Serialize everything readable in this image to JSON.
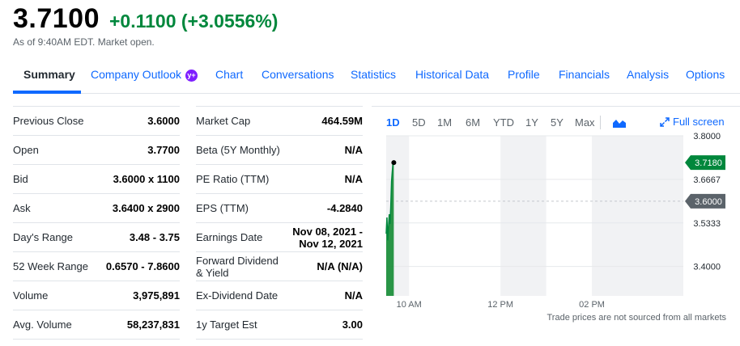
{
  "quote": {
    "price": "3.7100",
    "change": "+0.1100 (+3.0556%)",
    "status": "As of 9:40AM EDT. Market open."
  },
  "tabs": [
    {
      "label": "Summary"
    },
    {
      "label": "Company Outlook",
      "badge": "y+"
    },
    {
      "label": "Chart"
    },
    {
      "label": "Conversations"
    },
    {
      "label": "Statistics"
    },
    {
      "label": "Historical Data"
    },
    {
      "label": "Profile"
    },
    {
      "label": "Financials"
    },
    {
      "label": "Analysis"
    },
    {
      "label": "Options"
    }
  ],
  "left_stats": [
    {
      "label": "Previous Close",
      "value": "3.6000"
    },
    {
      "label": "Open",
      "value": "3.7700"
    },
    {
      "label": "Bid",
      "value": "3.6000 x 1100"
    },
    {
      "label": "Ask",
      "value": "3.6400 x 2900"
    },
    {
      "label": "Day's Range",
      "value": "3.48 - 3.75"
    },
    {
      "label": "52 Week Range",
      "value": "0.6570 - 7.8600"
    },
    {
      "label": "Volume",
      "value": "3,975,891"
    },
    {
      "label": "Avg. Volume",
      "value": "58,237,831"
    }
  ],
  "right_stats": [
    {
      "label": "Market Cap",
      "value": "464.59M"
    },
    {
      "label": "Beta (5Y Monthly)",
      "value": "N/A"
    },
    {
      "label": "PE Ratio (TTM)",
      "value": "N/A"
    },
    {
      "label": "EPS (TTM)",
      "value": "-4.2840"
    },
    {
      "label": "Earnings Date",
      "value": "Nov 08, 2021 - Nov 12, 2021"
    },
    {
      "label": "Forward Dividend & Yield",
      "value": "N/A (N/A)"
    },
    {
      "label": "Ex-Dividend Date",
      "value": "N/A"
    },
    {
      "label": "1y Target Est",
      "value": "3.00"
    }
  ],
  "chart": {
    "ranges": [
      "1D",
      "5D",
      "1M",
      "6M",
      "YTD",
      "1Y",
      "5Y",
      "Max"
    ],
    "active_range": "1D",
    "chart_type_icon": "mountain-chart-icon",
    "fullscreen_label": "Full screen",
    "disclaimer": "Trade prices are not sourced from all markets",
    "colors": {
      "line": "#00873c",
      "fill": "#1e8f3c",
      "accent": "#0f69ff"
    }
  },
  "chart_data": {
    "type": "area",
    "x_tick_labels": [
      "10 AM",
      "12 PM",
      "02 PM"
    ],
    "y_tick_labels": [
      "3.8000",
      "3.6667",
      "3.5333",
      "3.4000"
    ],
    "y_ticks": [
      3.8,
      3.6667,
      3.5333,
      3.4
    ],
    "ylim": [
      3.31,
      3.8
    ],
    "session_minutes": [
      0,
      390
    ],
    "x_ticks_minutes": [
      30,
      150,
      270
    ],
    "series": [
      {
        "x_minutes": [
          0,
          1,
          2,
          3,
          4,
          5,
          6,
          7,
          8,
          9,
          10
        ],
        "values": [
          3.5,
          3.55,
          3.48,
          3.52,
          3.56,
          3.53,
          3.58,
          3.66,
          3.69,
          3.72,
          3.718
        ]
      }
    ],
    "last_price_label": "3.7180",
    "previous_close": 3.6,
    "previous_close_label": "3.6000",
    "grid": true
  }
}
